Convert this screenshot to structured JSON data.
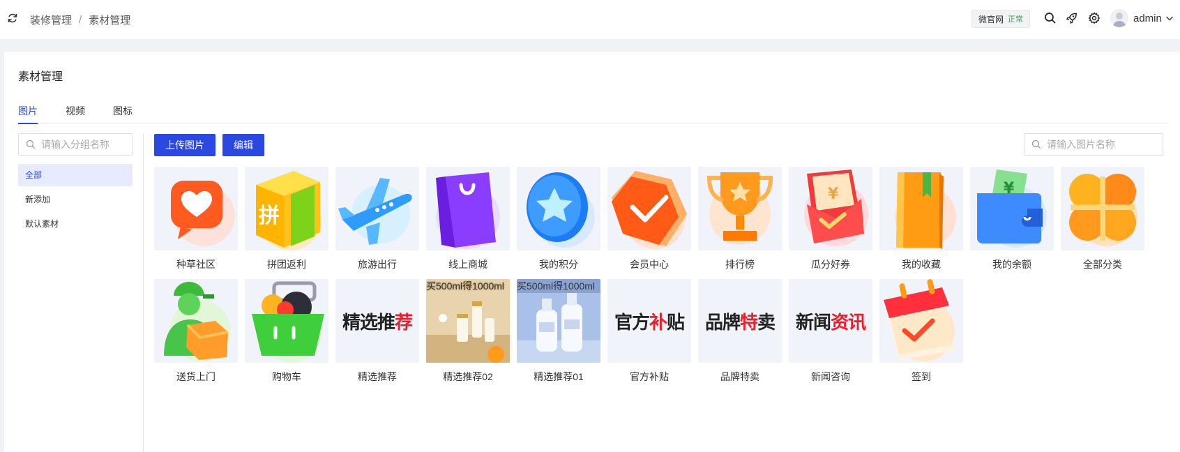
{
  "header": {
    "breadcrumb": [
      "装修管理",
      "素材管理"
    ],
    "breadcrumb_sep": "/",
    "site_tag": {
      "label": "微官网",
      "status": "正常"
    },
    "user": "admin"
  },
  "page": {
    "title": "素材管理"
  },
  "tabs": [
    {
      "label": "图片",
      "active": true
    },
    {
      "label": "视频",
      "active": false
    },
    {
      "label": "图标",
      "active": false
    }
  ],
  "sidebar": {
    "search_placeholder": "请输入分组名称",
    "groups": [
      {
        "label": "全部",
        "active": true
      },
      {
        "label": "新添加",
        "active": false
      },
      {
        "label": "默认素材",
        "active": false
      }
    ]
  },
  "toolbar": {
    "upload_label": "上传图片",
    "edit_label": "编辑",
    "search_placeholder": "请输入图片名称"
  },
  "images": [
    {
      "name": "种草社区",
      "icon": "heart-chat-icon"
    },
    {
      "name": "拼团返利",
      "icon": "group-box-icon",
      "glyph": "拼"
    },
    {
      "name": "旅游出行",
      "icon": "airplane-icon"
    },
    {
      "name": "线上商城",
      "icon": "shopping-bag-icon"
    },
    {
      "name": "我的积分",
      "icon": "star-coin-icon"
    },
    {
      "name": "会员中心",
      "icon": "member-badge-icon"
    },
    {
      "name": "排行榜",
      "icon": "trophy-icon"
    },
    {
      "name": "瓜分好券",
      "icon": "red-envelope-icon",
      "glyph": "¥"
    },
    {
      "name": "我的收藏",
      "icon": "bookmark-book-icon"
    },
    {
      "name": "我的余额",
      "icon": "wallet-icon",
      "glyph": "¥"
    },
    {
      "name": "全部分类",
      "icon": "clover-icon"
    },
    {
      "name": "送货上门",
      "icon": "delivery-person-icon"
    },
    {
      "name": "购物车",
      "icon": "shopping-basket-icon"
    },
    {
      "name": "精选推荐",
      "banner": [
        "精选推",
        "荐"
      ]
    },
    {
      "name": "精选推荐02",
      "photo": "买500ml得1000ml"
    },
    {
      "name": "精选推荐01",
      "photo": "买500ml得1000ml"
    },
    {
      "name": "官方补贴",
      "banner": [
        "官方",
        "补",
        "贴"
      ]
    },
    {
      "name": "品牌特卖",
      "banner": [
        "品牌",
        "特",
        "卖"
      ]
    },
    {
      "name": "新闻咨询",
      "banner": [
        "新闻",
        "资讯"
      ]
    },
    {
      "name": "签到",
      "icon": "calendar-check-icon"
    }
  ],
  "colors": {
    "primary": "#2b48e0",
    "status_ok": "#2fa84f",
    "accent_red": "#e8202c"
  }
}
